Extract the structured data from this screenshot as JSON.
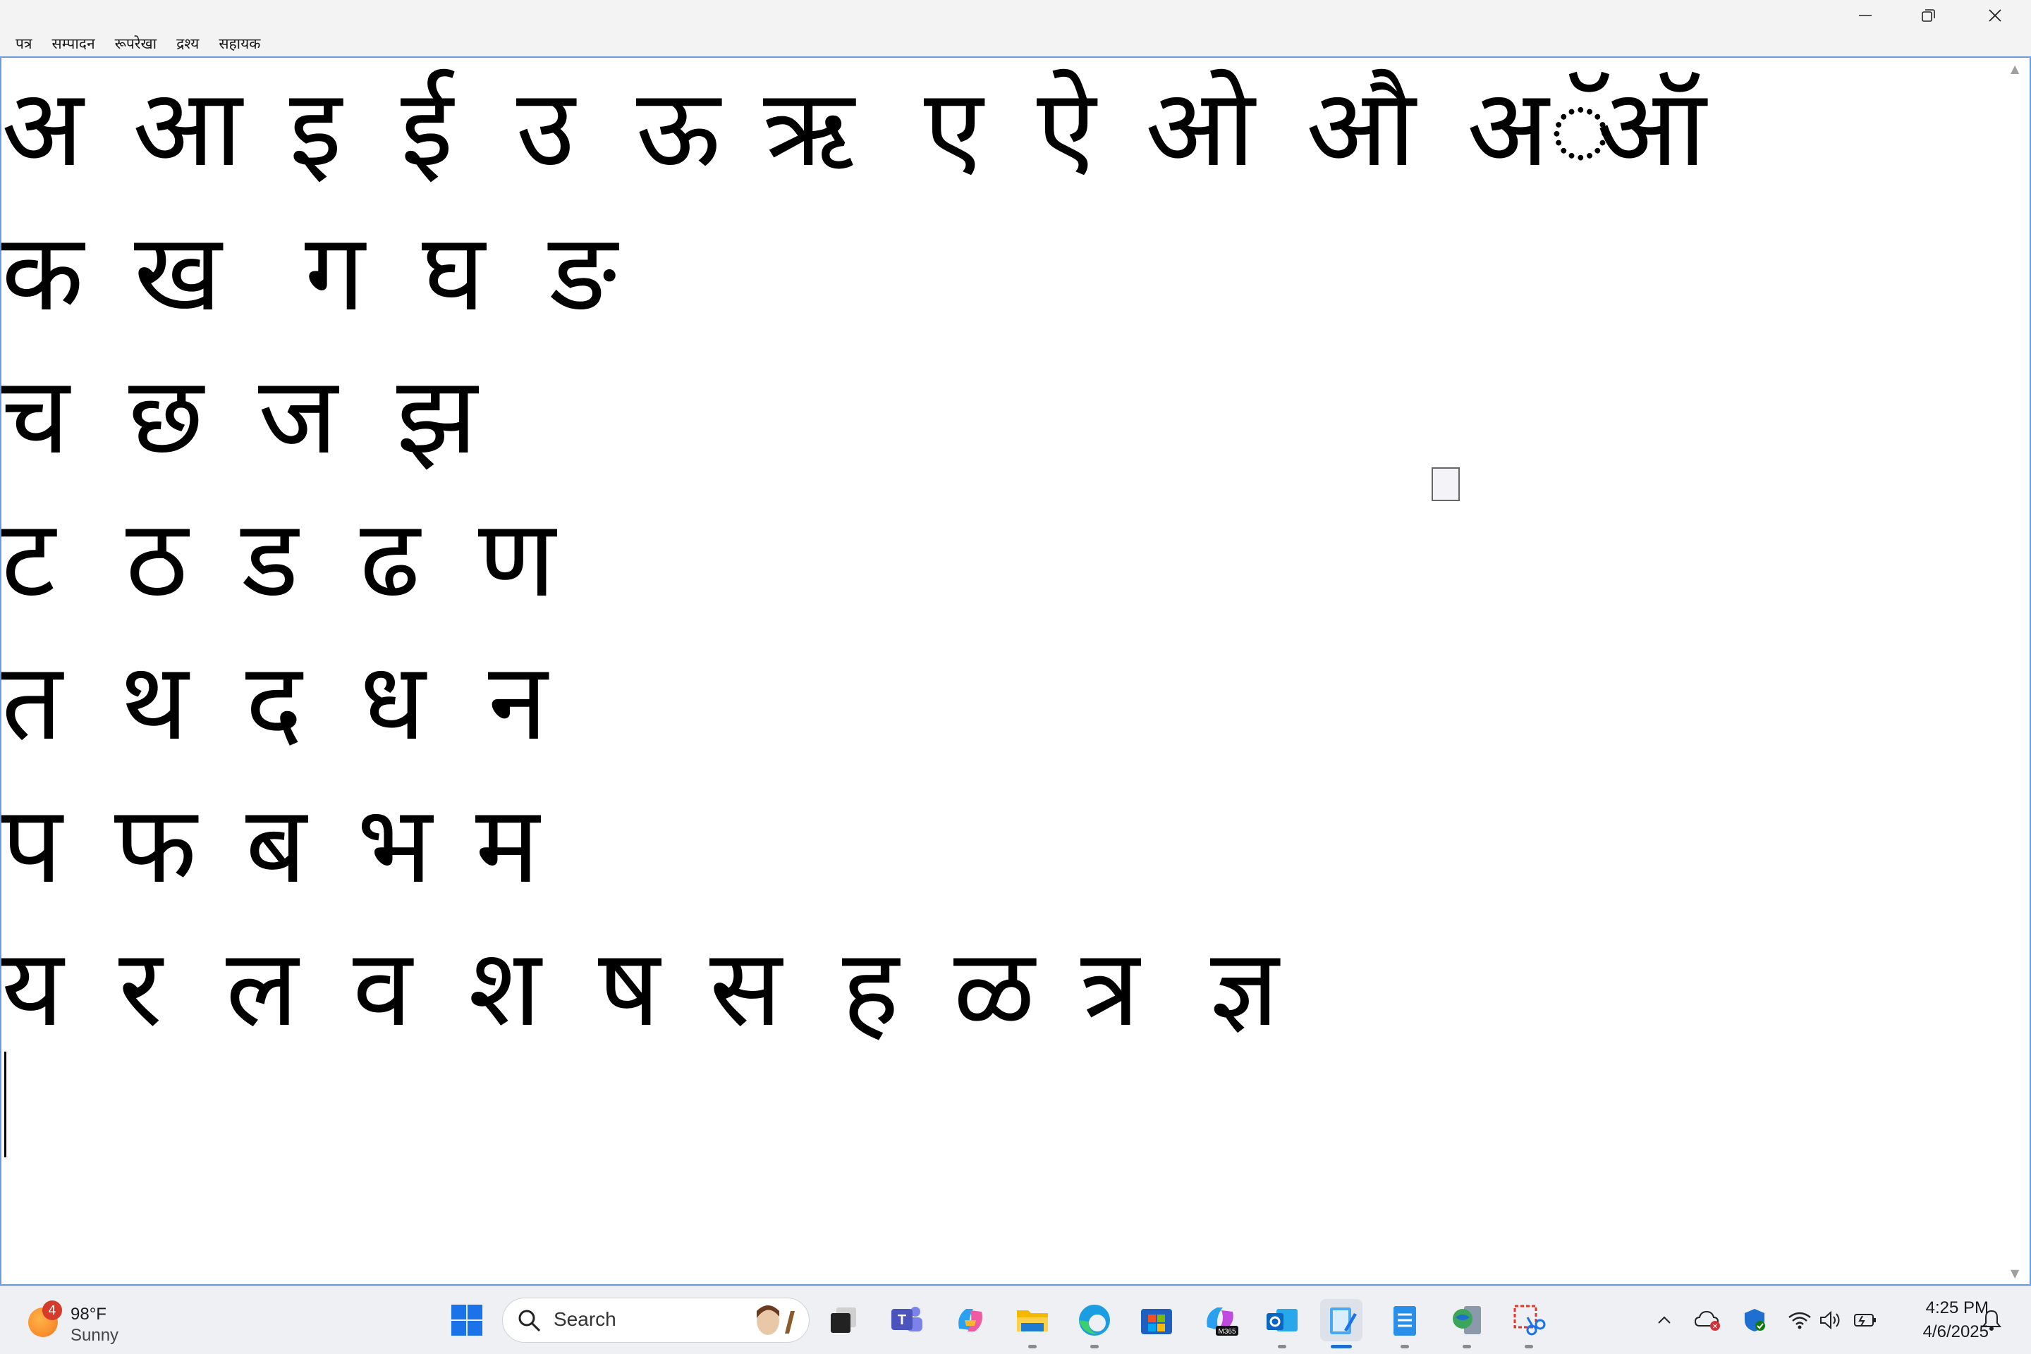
{
  "window": {
    "minimize_label": "",
    "restore_label": "",
    "close_label": ""
  },
  "menu": {
    "items": [
      "पत्र",
      "सम्पादन",
      "रूपरेखा",
      "द्रश्य",
      "सहायक"
    ]
  },
  "document": {
    "lines": [
      [
        "अ",
        "आ",
        "इ",
        "ई",
        "उ",
        "ऊ",
        "ऋ",
        "ए",
        "ऐ",
        "ओ",
        "औ",
        "अॅ",
        "ऑ"
      ],
      [
        "क",
        "ख",
        "ग",
        "घ",
        "ङ"
      ],
      [
        "च",
        "छ",
        "ज",
        "झ"
      ],
      [
        "ट",
        "ठ",
        "ड",
        "ढ",
        "ण"
      ],
      [
        "त",
        "थ",
        "द",
        "ध",
        "न"
      ],
      [
        "प",
        "फ",
        "ब",
        "भ",
        "म"
      ],
      [
        "य",
        "र",
        "ल",
        "व",
        "श",
        "ष",
        "स",
        "ह",
        "ळ",
        "त्र",
        "ज्ञ"
      ]
    ]
  },
  "taskbar": {
    "weather": {
      "badge": "4",
      "temperature": "98°F",
      "condition": "Sunny"
    },
    "search_placeholder": "Search",
    "apps": [
      {
        "name": "start",
        "icon": "windows-logo-icon",
        "active": false
      },
      {
        "name": "task-view",
        "icon": "task-view-icon",
        "active": false
      },
      {
        "name": "teams",
        "icon": "teams-icon",
        "active": false
      },
      {
        "name": "copilot",
        "icon": "copilot-icon",
        "active": false
      },
      {
        "name": "file-explorer",
        "icon": "folder-icon",
        "active": true
      },
      {
        "name": "edge",
        "icon": "edge-icon",
        "active": true
      },
      {
        "name": "store",
        "icon": "store-icon",
        "active": false
      },
      {
        "name": "m365",
        "icon": "m365-icon",
        "active": false
      },
      {
        "name": "outlook",
        "icon": "outlook-icon",
        "active": true
      },
      {
        "name": "notepad-active",
        "icon": "notepad-icon",
        "active": true
      },
      {
        "name": "notepad",
        "icon": "notepad-icon",
        "active": true
      },
      {
        "name": "network-app",
        "icon": "globe-icon",
        "active": true
      },
      {
        "name": "snipping-tool",
        "icon": "scissors-icon",
        "active": true
      }
    ],
    "clock": {
      "time": "4:25 PM",
      "date": "4/6/2025"
    },
    "colors": {
      "accent": "#1f6fd1",
      "taskbar_bg": "#eef0f4"
    }
  }
}
